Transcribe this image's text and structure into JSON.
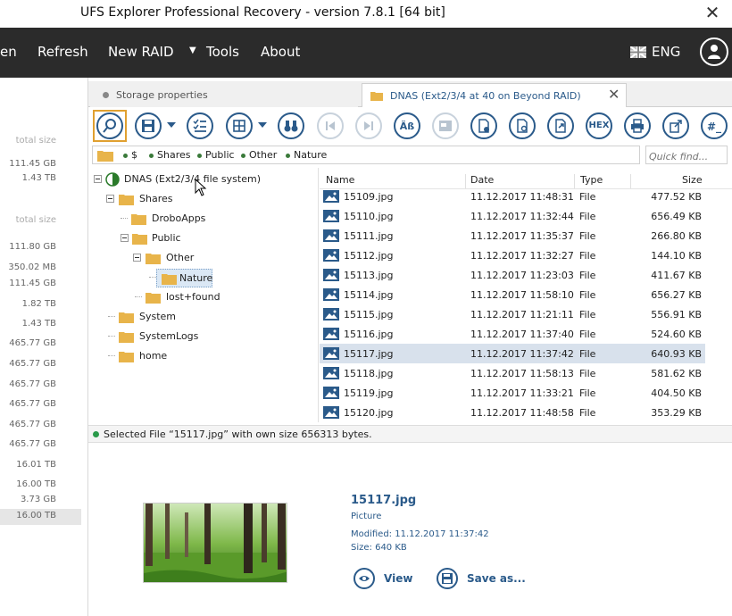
{
  "window": {
    "title": "UFS Explorer Professional Recovery - version 7.8.1 [64 bit]",
    "close": "✕"
  },
  "menu": {
    "items": [
      "en",
      "Refresh",
      "New RAID",
      "Tools",
      "About"
    ],
    "dropdown_arrow": "▼",
    "language": "ENG"
  },
  "sizes": {
    "header1": "total size",
    "group1": [
      "111.45 GB",
      "1.43 TB"
    ],
    "header2": "total size",
    "group2": [
      "111.80 GB",
      "350.02 MB",
      "111.45 GB",
      "1.82 TB",
      "1.43 TB",
      "465.77 GB",
      "465.77 GB",
      "465.77 GB",
      "465.77 GB",
      "465.77 GB",
      "465.77 GB",
      "16.01 TB",
      "16.00 TB",
      "3.73 GB",
      "16.00 TB"
    ]
  },
  "tabs": {
    "storage": "Storage properties",
    "dnas": "DNAS (Ext2/3/4 at 40 on Beyond RAID)",
    "close": "✕"
  },
  "toolbar": {
    "hex": "HEX",
    "hash": "#_"
  },
  "breadcrumb": [
    "$",
    "Shares",
    "Public",
    "Other",
    "Nature"
  ],
  "quickfind": {
    "placeholder": "Quick find..."
  },
  "tree": {
    "root": "DNAS (Ext2/3/4 file system)",
    "shares": "Shares",
    "droboapps": "DroboApps",
    "public": "Public",
    "other": "Other",
    "nature": "Nature",
    "lostfound": "lost+found",
    "system": "System",
    "systemlogs": "SystemLogs",
    "home": "home"
  },
  "files": {
    "columns": {
      "name": "Name",
      "date": "Date",
      "type": "Type",
      "size": "Size"
    },
    "rows": [
      {
        "name": "15109.jpg",
        "date": "11.12.2017 11:48:31",
        "type": "File",
        "size": "477.52 KB"
      },
      {
        "name": "15110.jpg",
        "date": "11.12.2017 11:32:44",
        "type": "File",
        "size": "656.49 KB"
      },
      {
        "name": "15111.jpg",
        "date": "11.12.2017 11:35:37",
        "type": "File",
        "size": "266.80 KB"
      },
      {
        "name": "15112.jpg",
        "date": "11.12.2017 11:32:27",
        "type": "File",
        "size": "144.10 KB"
      },
      {
        "name": "15113.jpg",
        "date": "11.12.2017 11:23:03",
        "type": "File",
        "size": "411.67 KB"
      },
      {
        "name": "15114.jpg",
        "date": "11.12.2017 11:58:10",
        "type": "File",
        "size": "656.27 KB"
      },
      {
        "name": "15115.jpg",
        "date": "11.12.2017 11:21:11",
        "type": "File",
        "size": "556.91 KB"
      },
      {
        "name": "15116.jpg",
        "date": "11.12.2017 11:37:40",
        "type": "File",
        "size": "524.60 KB"
      },
      {
        "name": "15117.jpg",
        "date": "11.12.2017 11:37:42",
        "type": "File",
        "size": "640.93 KB"
      },
      {
        "name": "15118.jpg",
        "date": "11.12.2017 11:58:13",
        "type": "File",
        "size": "581.62 KB"
      },
      {
        "name": "15119.jpg",
        "date": "11.12.2017 11:33:21",
        "type": "File",
        "size": "404.50 KB"
      },
      {
        "name": "15120.jpg",
        "date": "11.12.2017 11:48:58",
        "type": "File",
        "size": "353.29 KB"
      }
    ],
    "selected_index": 8
  },
  "status": {
    "text": "Selected File “15117.jpg” with own size 656313 bytes."
  },
  "preview": {
    "name": "15117.jpg",
    "type": "Picture",
    "modified": "Modified: 11.12.2017 11:37:42",
    "size": "Size: 640 KB",
    "view": "View",
    "save": "Save as..."
  },
  "colors": {
    "accent": "#2a5a8a",
    "menubar": "#2b2b2b",
    "selection": "#d8e1ec",
    "highlight_frame": "#e0a030"
  }
}
